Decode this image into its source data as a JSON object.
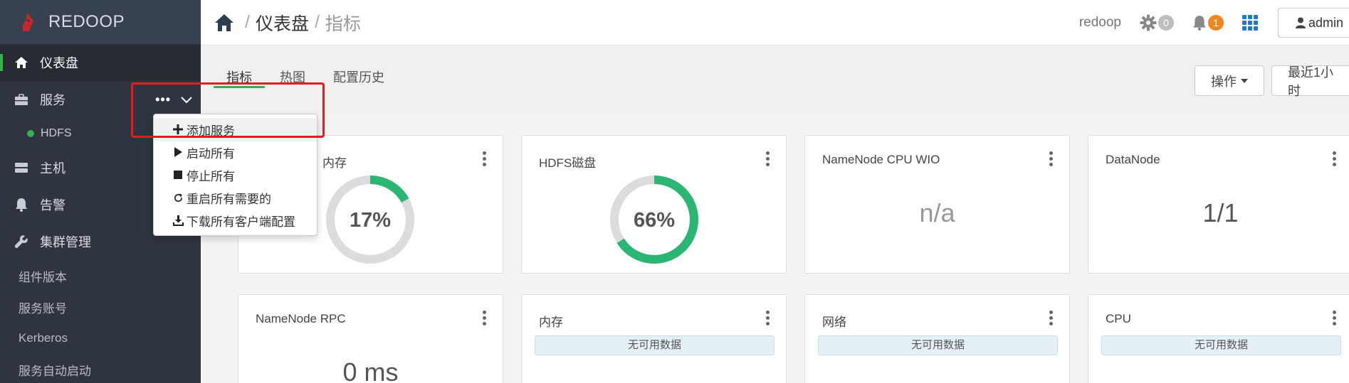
{
  "brand": {
    "name": "REDOOP"
  },
  "sidebar": {
    "dashboard": "仪表盘",
    "services": "服务",
    "service_list": [
      {
        "name": "HDFS",
        "status_color": "#35b34a"
      }
    ],
    "hosts": "主机",
    "alerts": "告警",
    "cluster_admin": "集群管理",
    "admin_links": [
      "组件版本",
      "服务账号",
      "Kerberos",
      "服务自动启动"
    ]
  },
  "service_menu": {
    "items": [
      {
        "label": "添加服务",
        "icon": "plus-icon"
      },
      {
        "label": "启动所有",
        "icon": "play-icon"
      },
      {
        "label": "停止所有",
        "icon": "stop-icon"
      },
      {
        "label": "重启所有需要的",
        "icon": "refresh-icon"
      },
      {
        "label": "下载所有客户端配置",
        "icon": "download-icon"
      }
    ]
  },
  "breadcrumb": {
    "sep": "/",
    "current": "仪表盘",
    "last": "指标"
  },
  "topbar": {
    "user": "redoop",
    "ops_count": "0",
    "alerts_count": "1",
    "admin": "admin"
  },
  "tabs": [
    "指标",
    "热图",
    "配置历史"
  ],
  "buttons": {
    "actions": "操作",
    "time_range": "最近1小时"
  },
  "widgets": [
    {
      "title": "内存",
      "type": "gauge",
      "value": "17%",
      "percent": 17
    },
    {
      "title": "HDFS磁盘",
      "type": "gauge",
      "value": "66%",
      "percent": 66
    },
    {
      "title": "NameNode CPU WIO",
      "type": "text",
      "value": "n/a"
    },
    {
      "title": "DataNode",
      "type": "text",
      "value": "1/1"
    },
    {
      "title": "NameNode RPC",
      "type": "text",
      "value": "0 ms"
    },
    {
      "title": "内存",
      "type": "nodata",
      "value": "无可用数据"
    },
    {
      "title": "网络",
      "type": "nodata",
      "value": "无可用数据"
    },
    {
      "title": "CPU",
      "type": "nodata",
      "value": "无可用数据"
    }
  ],
  "colors": {
    "accent": "#35b34a",
    "sidebar": "#2f3540",
    "highlight": "#e8191f",
    "alert_badge": "#f0861f"
  }
}
